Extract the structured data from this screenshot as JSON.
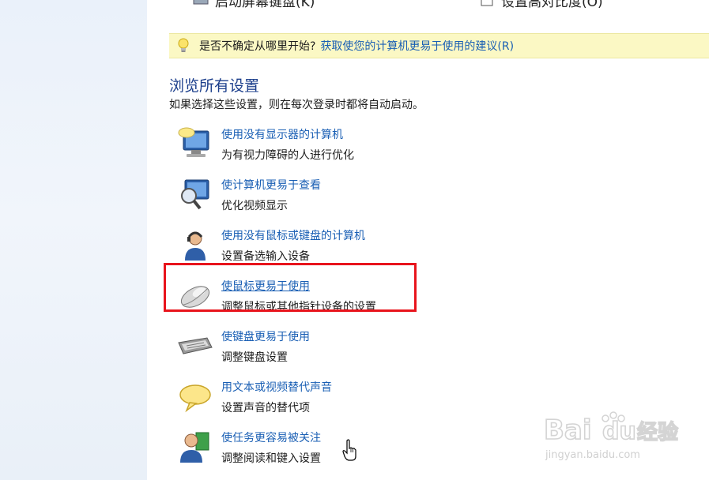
{
  "top_row": {
    "left_label": "启动屏幕键盘(K)",
    "right_label": "设置高对比度(O)"
  },
  "hint": {
    "text": "是否不确定从哪里开始?",
    "link": "获取使您的计算机更易于使用的建议(R)",
    "icon": "lightbulb-icon"
  },
  "section": {
    "title": "浏览所有设置",
    "description": "如果选择这些设置，则在每次登录时都将自动启动。"
  },
  "items": [
    {
      "link": "使用没有显示器的计算机",
      "desc": "为有视力障碍的人进行优化",
      "icon": "monitor-speech-icon"
    },
    {
      "link": "使计算机更易于查看",
      "desc": "优化视频显示",
      "icon": "monitor-magnifier-icon"
    },
    {
      "link": "使用没有鼠标或键盘的计算机",
      "desc": "设置备选输入设备",
      "icon": "person-headset-icon"
    },
    {
      "link": "使鼠标更易于使用",
      "desc": "调整鼠标或其他指针设备的设置",
      "icon": "mouse-icon"
    },
    {
      "link": "使键盘更易于使用",
      "desc": "调整键盘设置",
      "icon": "keyboard-icon"
    },
    {
      "link": "用文本或视频替代声音",
      "desc": "设置声音的替代项",
      "icon": "speech-bubble-icon"
    },
    {
      "link": "使任务更容易被关注",
      "desc": "调整阅读和键入设置",
      "icon": "person-book-icon"
    }
  ],
  "watermark": {
    "brand": "Bai",
    "brand2": "du",
    "suffix": "经验",
    "url": "jingyan.baidu.com"
  },
  "colors": {
    "link": "#1a5fb4",
    "highlight": "#e8141c",
    "hint_bg": "#fbf8c4"
  }
}
